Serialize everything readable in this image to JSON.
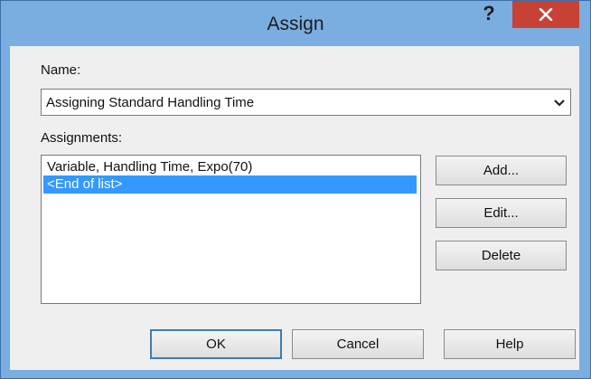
{
  "dialog": {
    "title": "Assign",
    "help_glyph": "?",
    "close_icon": "close-icon"
  },
  "name": {
    "label": "Name:",
    "value": "Assigning Standard Handling Time"
  },
  "assignments": {
    "label": "Assignments:",
    "items": [
      "Variable, Handling Time, Expo(70)",
      "<End of list>"
    ],
    "selected_index": 1
  },
  "side_buttons": {
    "add": "Add...",
    "edit": "Edit...",
    "delete": "Delete"
  },
  "footer_buttons": {
    "ok": "OK",
    "cancel": "Cancel",
    "help": "Help"
  },
  "colors": {
    "title_bar": "#7aaee0",
    "close_button": "#c84135",
    "selection": "#3399ff"
  }
}
